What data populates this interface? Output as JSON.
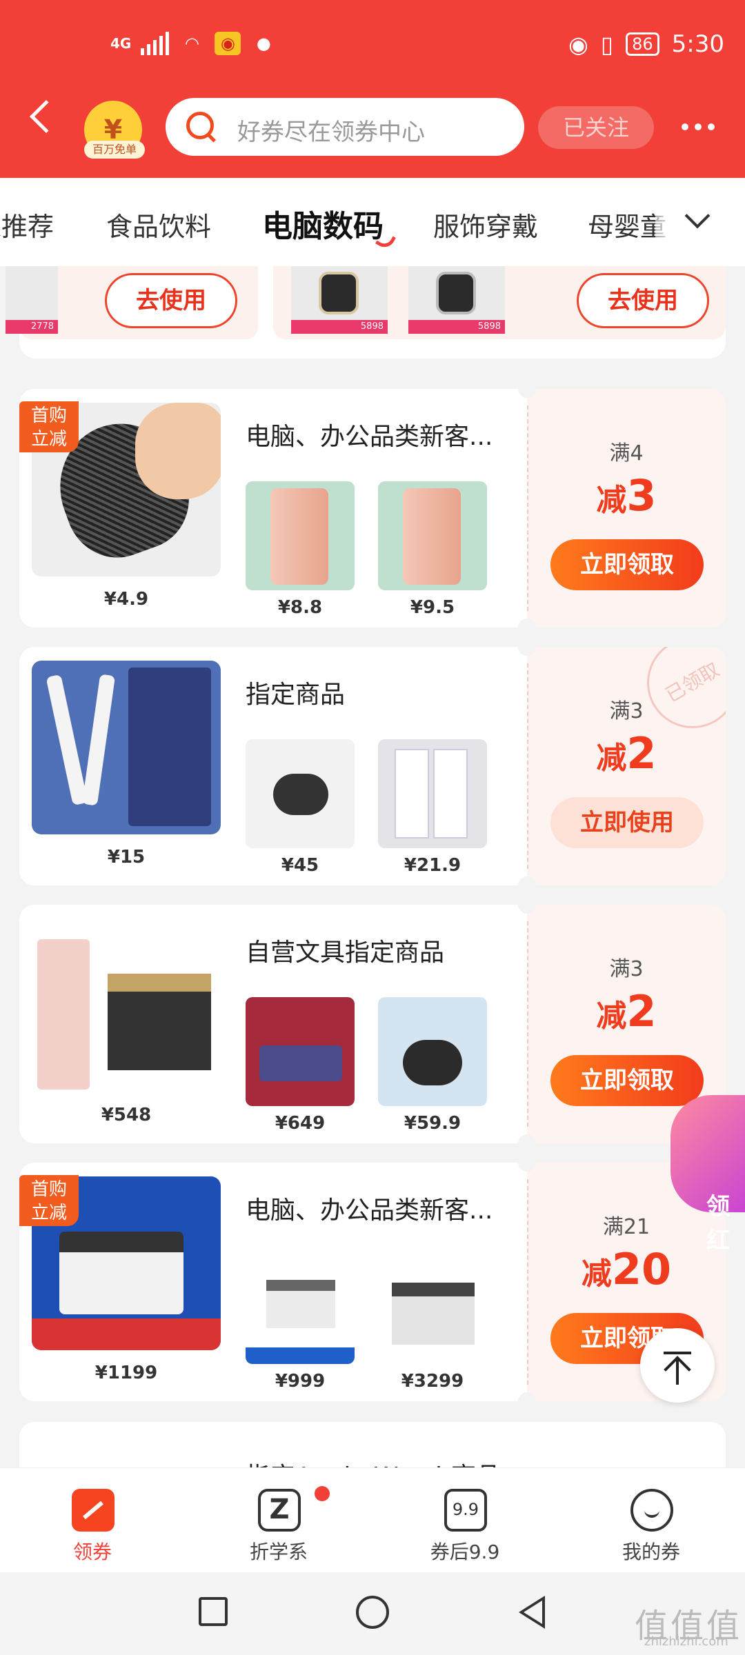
{
  "status_bar": {
    "signal": "4G",
    "battery": "86",
    "time": "5:30"
  },
  "header": {
    "back_icon": "chevron-left-icon",
    "mascot_label": "百万免单",
    "search_placeholder": "好券尽在领券中心",
    "follow_label": "已关注",
    "more_icon": "more-dots-icon",
    "brand_color": "#f23f37"
  },
  "tabs": [
    "X推荐",
    "食品饮料",
    "电脑数码",
    "服饰穿戴",
    "母婴童"
  ],
  "active_tab_index": 2,
  "top_card": {
    "price_left": "2778",
    "price_a": "5898",
    "price_b": "5898",
    "use_label": "去使用"
  },
  "cards": [
    {
      "badge": [
        "首购",
        "立减"
      ],
      "title": "电脑、办公品类新客...",
      "main_price": "¥4.9",
      "thumb_prices": [
        "¥8.8",
        "¥9.5"
      ],
      "threshold": "满4",
      "prefix": "减",
      "amount": "3",
      "button": "立即领取",
      "claimed": false
    },
    {
      "badge": null,
      "title": "指定商品",
      "main_price": "¥15",
      "thumb_prices": [
        "¥45",
        "¥21.9"
      ],
      "threshold": "满3",
      "prefix": "减",
      "amount": "2",
      "button": "立即使用",
      "claimed": true,
      "stamp": "已领取"
    },
    {
      "badge": null,
      "title": "自营文具指定商品",
      "main_price": "¥548",
      "thumb_prices": [
        "¥649",
        "¥59.9"
      ],
      "threshold": "满3",
      "prefix": "减",
      "amount": "2",
      "button": "立即领取",
      "claimed": false
    },
    {
      "badge": [
        "首购",
        "立减"
      ],
      "title": "电脑、办公品类新客...",
      "main_price": "¥1199",
      "thumb_prices": [
        "¥999",
        "¥3299"
      ],
      "threshold": "满21",
      "prefix": "减",
      "amount": "20",
      "button": "立即领取",
      "claimed": false
    }
  ],
  "partial_card": {
    "title": "指定Apple Watch商品"
  },
  "floating": {
    "promo_text": "领红",
    "top_icon": "arrow-up-to-top-icon"
  },
  "bottom_nav": [
    {
      "label": "领券",
      "icon": "coupon-icon",
      "active": true
    },
    {
      "label": "折学系",
      "icon": "z-logo-icon",
      "active": false,
      "dot": true
    },
    {
      "label": "券后9.9",
      "icon": "price-9-9-icon",
      "active": false,
      "icon_text": "9.9"
    },
    {
      "label": "我的券",
      "icon": "smile-icon",
      "active": false
    }
  ],
  "watermark": {
    "text": "值值值",
    "url": "zhizhizhi.com"
  }
}
